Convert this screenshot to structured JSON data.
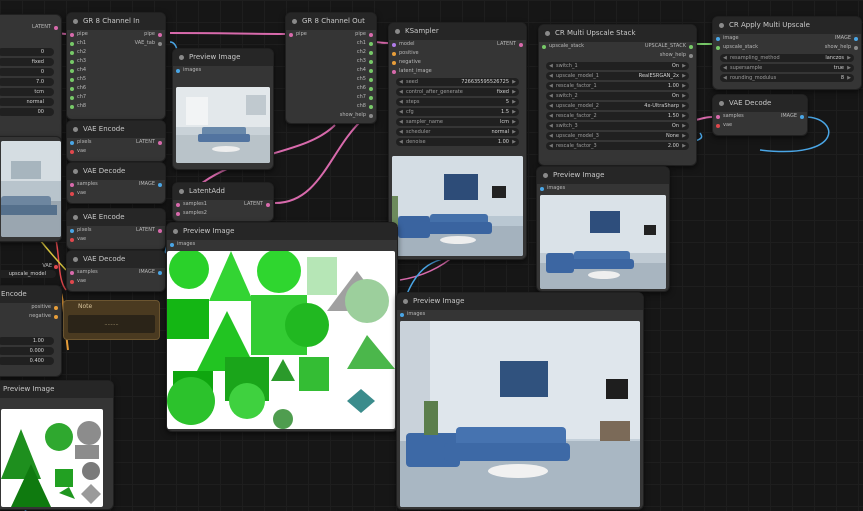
{
  "colors": {
    "pink": "#d86aac",
    "blue": "#4aa6e6",
    "green": "#77c968",
    "yellow": "#d5c23e",
    "red": "#e0484d",
    "orange": "#e89e3a",
    "violet": "#b07be8",
    "grey": "#8a8a8a"
  },
  "left_partial": {
    "latent_out": "LATENT",
    "widgets": [
      {
        "name": "",
        "value": "0"
      },
      {
        "name": "",
        "value": "fixed"
      },
      {
        "name": "",
        "value": "0"
      },
      {
        "name": "",
        "value": "7.0"
      },
      {
        "name": "",
        "value": "tcm"
      },
      {
        "name": "",
        "value": "normal"
      },
      {
        "name": "",
        "value": "00"
      }
    ]
  },
  "channel_in": {
    "title": "GR 8 Channel In",
    "inputs": [
      "pipe",
      "ch1",
      "ch2",
      "ch3",
      "ch4",
      "ch5",
      "ch6",
      "ch7",
      "ch8"
    ],
    "outputs": [
      "pipe",
      "VAE_tab"
    ]
  },
  "channel_out": {
    "title": "GR 8 Channel Out",
    "inputs": [
      "pipe"
    ],
    "outputs": [
      "pipe",
      "ch1",
      "ch2",
      "ch3",
      "ch4",
      "ch5",
      "ch6",
      "ch7",
      "ch8",
      "show_help"
    ]
  },
  "preview1": {
    "title": "Preview Image",
    "input": "images"
  },
  "vae_encode1": {
    "title": "VAE Encode",
    "inputs": [
      "pixels",
      "vae"
    ],
    "output": "LATENT"
  },
  "vae_decode_left": {
    "title": "VAE Decode",
    "inputs": [
      "samples",
      "vae"
    ],
    "output": "IMAGE"
  },
  "latent_add": {
    "title": "LatentAdd",
    "inputs": [
      "samples1",
      "samples2"
    ],
    "output": "LATENT"
  },
  "vae_encode2": {
    "title": "VAE Encode",
    "inputs": [
      "pixels",
      "vae"
    ],
    "output": "LATENT"
  },
  "vae_decode2": {
    "title": "VAE Decode",
    "inputs": [
      "samples",
      "vae"
    ],
    "output": "IMAGE"
  },
  "note": {
    "title": "Note",
    "text": "........."
  },
  "conditioning": {
    "title": "Encode",
    "inputs": [
      "positive",
      "negative"
    ],
    "values": [
      "1.00",
      "0.000",
      "0.400"
    ]
  },
  "preview_left": {
    "title": "Preview Image"
  },
  "left_mid": {
    "label": "VAE",
    "widget": "upscale_model"
  },
  "ksampler": {
    "title": "KSampler",
    "inputs": [
      "model",
      "positive",
      "negative",
      "latent_image"
    ],
    "output": "LATENT",
    "widgets": [
      {
        "name": "seed",
        "value": "726635595526725"
      },
      {
        "name": "control_after_generate",
        "value": "fixed"
      },
      {
        "name": "steps",
        "value": "5"
      },
      {
        "name": "cfg",
        "value": "1.5"
      },
      {
        "name": "sampler_name",
        "value": "lcm"
      },
      {
        "name": "scheduler",
        "value": "normal"
      },
      {
        "name": "denoise",
        "value": "1.00"
      }
    ]
  },
  "upscale_stack": {
    "title": "CR Multi Upscale Stack",
    "inputs": [
      "upscale_stack"
    ],
    "outputs": [
      "UPSCALE_STACK",
      "show_help"
    ],
    "widgets": [
      {
        "name": "switch_1",
        "value": "On"
      },
      {
        "name": "upscale_model_1",
        "value": "RealESRGAN_2x"
      },
      {
        "name": "rescale_factor_1",
        "value": "1.00"
      },
      {
        "name": "switch_2",
        "value": "On"
      },
      {
        "name": "upscale_model_2",
        "value": "4x-UltraSharp"
      },
      {
        "name": "rescale_factor_2",
        "value": "1.50"
      },
      {
        "name": "switch_3",
        "value": "On"
      },
      {
        "name": "upscale_model_3",
        "value": "None"
      },
      {
        "name": "rescale_factor_3",
        "value": "2.00"
      }
    ]
  },
  "apply_upscale": {
    "title": "CR Apply Multi Upscale",
    "inputs": [
      "image",
      "upscale_stack"
    ],
    "outputs": [
      "IMAGE",
      "show_help"
    ],
    "widgets": [
      {
        "name": "resampling_method",
        "value": "lanczos"
      },
      {
        "name": "supersample",
        "value": "true"
      },
      {
        "name": "rounding_modulus",
        "value": "8"
      }
    ]
  },
  "vae_decode_right": {
    "title": "VAE Decode",
    "inputs": [
      "samples",
      "vae"
    ],
    "output": "IMAGE"
  },
  "preview_ksampler": {
    "title": "Preview Image",
    "input": "images"
  },
  "preview_upscale": {
    "title": "Preview Image",
    "input": "images"
  },
  "preview_shapes": {
    "title": "Preview Image",
    "input": "images"
  },
  "preview_big": {
    "title": "Preview Image",
    "input": "images"
  }
}
